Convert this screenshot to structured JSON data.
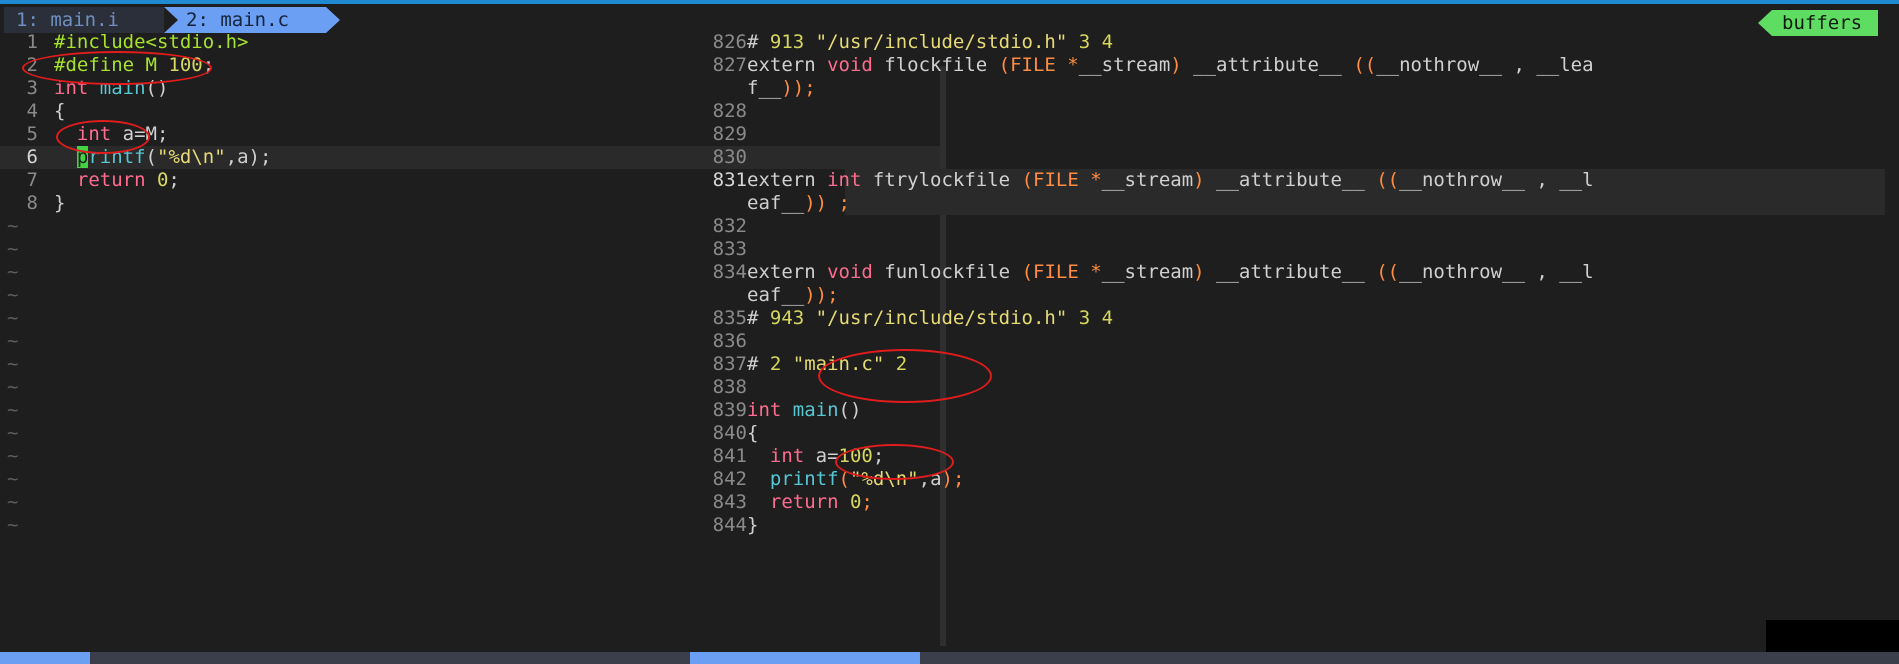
{
  "tabs": [
    {
      "label": "1: main.i"
    },
    {
      "label": "2: main.c"
    }
  ],
  "buffers_label": "buffers",
  "left_lines": [
    {
      "n": "1",
      "parts": [
        [
          "c-pre",
          "#include<stdio.h>"
        ]
      ]
    },
    {
      "n": "2",
      "parts": [
        [
          "c-pre",
          "#define M "
        ],
        [
          "c-num",
          "100"
        ],
        [
          "c-txt",
          ";"
        ]
      ]
    },
    {
      "n": "3",
      "parts": [
        [
          "c-kw",
          "int "
        ],
        [
          "c-fn",
          "main"
        ],
        [
          "c-txt",
          "()"
        ]
      ]
    },
    {
      "n": "4",
      "parts": [
        [
          "c-txt",
          "{"
        ]
      ]
    },
    {
      "n": "5",
      "parts": [
        [
          "c-txt",
          "  "
        ],
        [
          "c-kw",
          "int"
        ],
        [
          "c-txt",
          " a=M;"
        ]
      ]
    },
    {
      "n": "6",
      "parts": [
        [
          "c-txt",
          "  "
        ],
        [
          "cursor",
          "p"
        ],
        [
          "c-fn",
          "rintf"
        ],
        [
          "c-txt",
          "("
        ],
        [
          "c-str",
          "\"%d\\n\""
        ],
        [
          "c-txt",
          ",a);"
        ]
      ]
    },
    {
      "n": "7",
      "parts": [
        [
          "c-txt",
          "  "
        ],
        [
          "c-kw",
          "return "
        ],
        [
          "c-num",
          "0"
        ],
        [
          "c-txt",
          ";"
        ]
      ]
    },
    {
      "n": "8",
      "parts": [
        [
          "c-txt",
          "}"
        ]
      ]
    }
  ],
  "right_lines": [
    {
      "n": "826",
      "parts": [
        [
          "c-txt",
          "# "
        ],
        [
          "c-num",
          "913 "
        ],
        [
          "c-str",
          "\"/usr/include/stdio.h\" "
        ],
        [
          "c-num",
          "3 4"
        ]
      ]
    },
    {
      "n": "827",
      "parts": [
        [
          "c-txt",
          "extern "
        ],
        [
          "c-kw",
          "void "
        ],
        [
          "c-txt",
          "flockfile "
        ],
        [
          "c-op",
          "(FILE *"
        ],
        [
          "c-txt",
          "__stream"
        ],
        [
          "c-op",
          ")"
        ],
        [
          "c-txt",
          " __attribute__ "
        ],
        [
          "c-op",
          "(("
        ],
        [
          "c-txt",
          "__nothrow__ , __lea"
        ]
      ]
    },
    {
      "n": "",
      "parts": [
        [
          "c-txt",
          "f__"
        ],
        [
          "c-op",
          "));"
        ]
      ]
    },
    {
      "n": "828",
      "parts": []
    },
    {
      "n": "829",
      "parts": []
    },
    {
      "n": "830",
      "parts": []
    },
    {
      "n": "831",
      "parts": [
        [
          "c-txt",
          "extern "
        ],
        [
          "c-kw",
          "int "
        ],
        [
          "c-txt",
          "ftrylockfile "
        ],
        [
          "c-op",
          "(FILE *"
        ],
        [
          "c-txt",
          "__stream"
        ],
        [
          "c-op",
          ")"
        ],
        [
          "c-txt",
          " __attribute__ "
        ],
        [
          "c-op",
          "(("
        ],
        [
          "c-txt",
          "__nothrow__ , __l"
        ]
      ]
    },
    {
      "n": "",
      "parts": [
        [
          "c-txt",
          "eaf__"
        ],
        [
          "c-op",
          ")) ;"
        ]
      ]
    },
    {
      "n": "832",
      "parts": []
    },
    {
      "n": "833",
      "parts": []
    },
    {
      "n": "834",
      "parts": [
        [
          "c-txt",
          "extern "
        ],
        [
          "c-kw",
          "void "
        ],
        [
          "c-txt",
          "funlockfile "
        ],
        [
          "c-op",
          "(FILE *"
        ],
        [
          "c-txt",
          "__stream"
        ],
        [
          "c-op",
          ")"
        ],
        [
          "c-txt",
          " __attribute__ "
        ],
        [
          "c-op",
          "(("
        ],
        [
          "c-txt",
          "__nothrow__ , __l"
        ]
      ]
    },
    {
      "n": "",
      "parts": [
        [
          "c-txt",
          "eaf__"
        ],
        [
          "c-op",
          "));"
        ]
      ]
    },
    {
      "n": "835",
      "parts": [
        [
          "c-txt",
          "# "
        ],
        [
          "c-num",
          "943 "
        ],
        [
          "c-str",
          "\"/usr/include/stdio.h\" "
        ],
        [
          "c-num",
          "3 4"
        ]
      ]
    },
    {
      "n": "836",
      "parts": []
    },
    {
      "n": "837",
      "parts": [
        [
          "c-txt",
          "# "
        ],
        [
          "c-num",
          "2 "
        ],
        [
          "c-str",
          "\"main.c\" "
        ],
        [
          "c-num",
          "2"
        ]
      ]
    },
    {
      "n": "838",
      "parts": []
    },
    {
      "n": "839",
      "parts": [
        [
          "c-kw",
          "int "
        ],
        [
          "c-fn",
          "main"
        ],
        [
          "c-txt",
          "()"
        ]
      ]
    },
    {
      "n": "840",
      "parts": [
        [
          "c-txt",
          "{"
        ]
      ]
    },
    {
      "n": "841",
      "parts": [
        [
          "c-txt",
          "  "
        ],
        [
          "c-kw",
          "int"
        ],
        [
          "c-txt",
          " a="
        ],
        [
          "c-num",
          "100"
        ],
        [
          "c-txt",
          ";"
        ]
      ]
    },
    {
      "n": "842",
      "parts": [
        [
          "c-txt",
          "  "
        ],
        [
          "c-fn",
          "printf"
        ],
        [
          "c-op",
          "("
        ],
        [
          "c-str",
          "\"%d\\n\""
        ],
        [
          "c-txt",
          ",a"
        ],
        [
          "c-op",
          ");"
        ]
      ]
    },
    {
      "n": "843",
      "parts": [
        [
          "c-txt",
          "  "
        ],
        [
          "c-kw",
          "return "
        ],
        [
          "c-num",
          "0"
        ],
        [
          "c-op",
          ";"
        ]
      ]
    },
    {
      "n": "844",
      "parts": [
        [
          "c-txt",
          "}"
        ]
      ]
    }
  ],
  "tilde": "~",
  "tilde_count": 14,
  "cursor_line_left": "6",
  "cursor_line_right": "831"
}
